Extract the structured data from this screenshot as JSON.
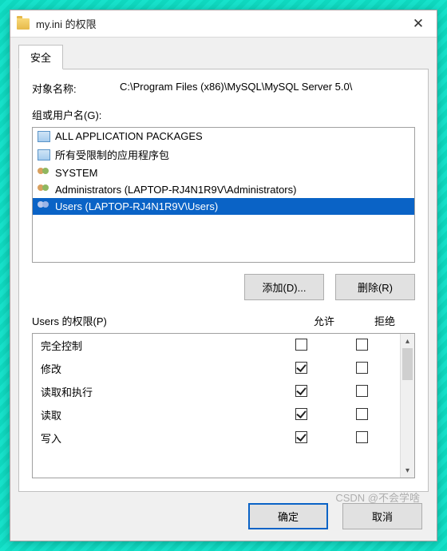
{
  "title": "my.ini 的权限",
  "tab": "安全",
  "object_name_label": "对象名称:",
  "object_name_value": "C:\\Program Files (x86)\\MySQL\\MySQL Server 5.0\\",
  "groups_label": "组或用户名(G):",
  "groups": [
    {
      "icon": "pkg",
      "label": "ALL APPLICATION PACKAGES",
      "selected": false
    },
    {
      "icon": "pkg",
      "label": "所有受限制的应用程序包",
      "selected": false
    },
    {
      "icon": "usr",
      "label": "SYSTEM",
      "selected": false
    },
    {
      "icon": "usr",
      "label": "Administrators (LAPTOP-RJ4N1R9V\\Administrators)",
      "selected": false
    },
    {
      "icon": "usr",
      "label": "Users (LAPTOP-RJ4N1R9V\\Users)",
      "selected": true
    }
  ],
  "buttons": {
    "add": "添加(D)...",
    "remove": "删除(R)",
    "ok": "确定",
    "cancel": "取消"
  },
  "perm_header": {
    "title": "Users 的权限(P)",
    "allow": "允许",
    "deny": "拒绝"
  },
  "permissions": [
    {
      "name": "完全控制",
      "allow": false,
      "deny": false
    },
    {
      "name": "修改",
      "allow": true,
      "deny": false
    },
    {
      "name": "读取和执行",
      "allow": true,
      "deny": false
    },
    {
      "name": "读取",
      "allow": true,
      "deny": false
    },
    {
      "name": "写入",
      "allow": true,
      "deny": false
    }
  ],
  "watermark": "CSDN @不会学啥"
}
